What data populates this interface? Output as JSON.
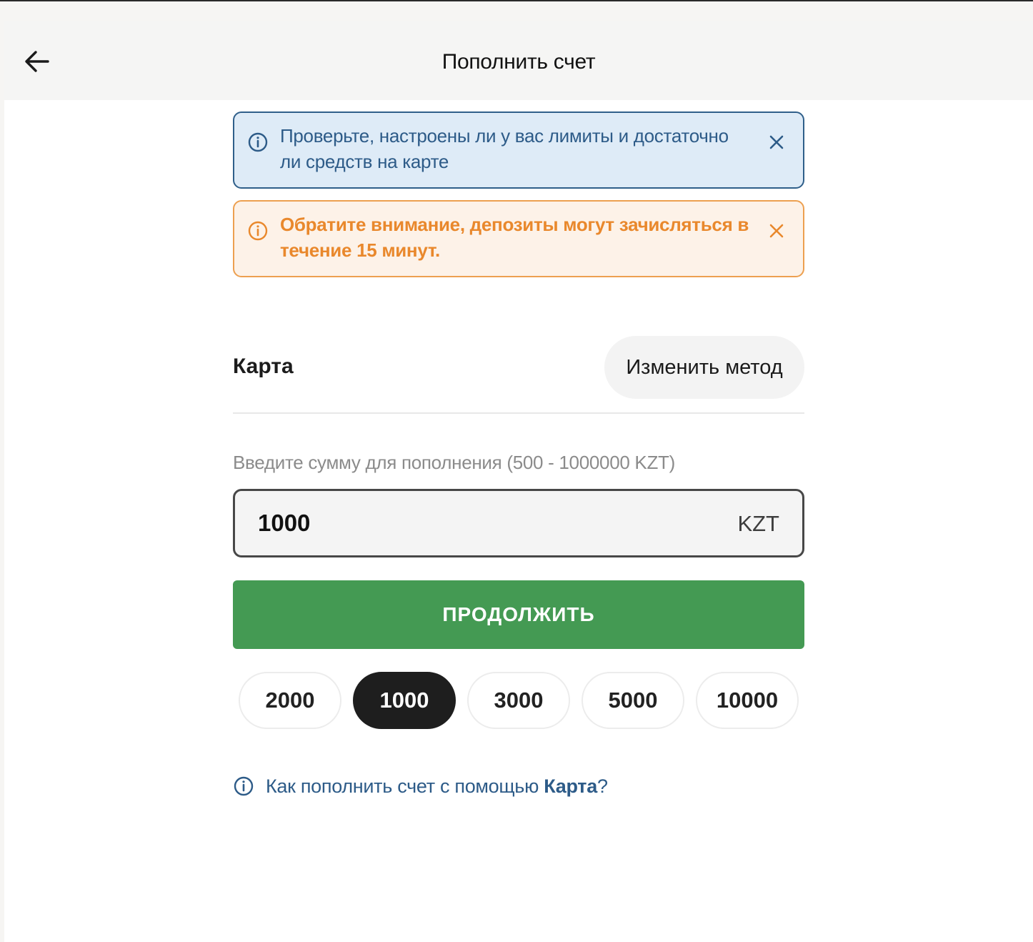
{
  "header": {
    "title": "Пополнить счет",
    "back_icon": "arrow-left-icon"
  },
  "alerts": [
    {
      "type": "info",
      "text": "Проверьте, настроены ли у вас лимиты и достаточно ли средств на карте",
      "icon": "info-icon",
      "close_icon": "close-icon",
      "color": "#2d5b88"
    },
    {
      "type": "warning",
      "text": "Обратите внимание, депозиты могут зачисляться в течение 15 минут.",
      "icon": "info-icon",
      "close_icon": "close-icon",
      "color": "#e9882c"
    }
  ],
  "method": {
    "name": "Карта",
    "change_label": "Изменить метод"
  },
  "amount": {
    "label": "Введите сумму для пополнения (500 - 1000000 KZT)",
    "value": "1000",
    "currency": "KZT"
  },
  "continue_label": "ПРОДОЛЖИТЬ",
  "continue_color": "#449a53",
  "presets": [
    "2000",
    "1000",
    "3000",
    "5000",
    "10000"
  ],
  "selected_preset": "1000",
  "help": {
    "prefix": "Как пополнить счет с помощью ",
    "method": "Карта",
    "suffix": "?"
  }
}
